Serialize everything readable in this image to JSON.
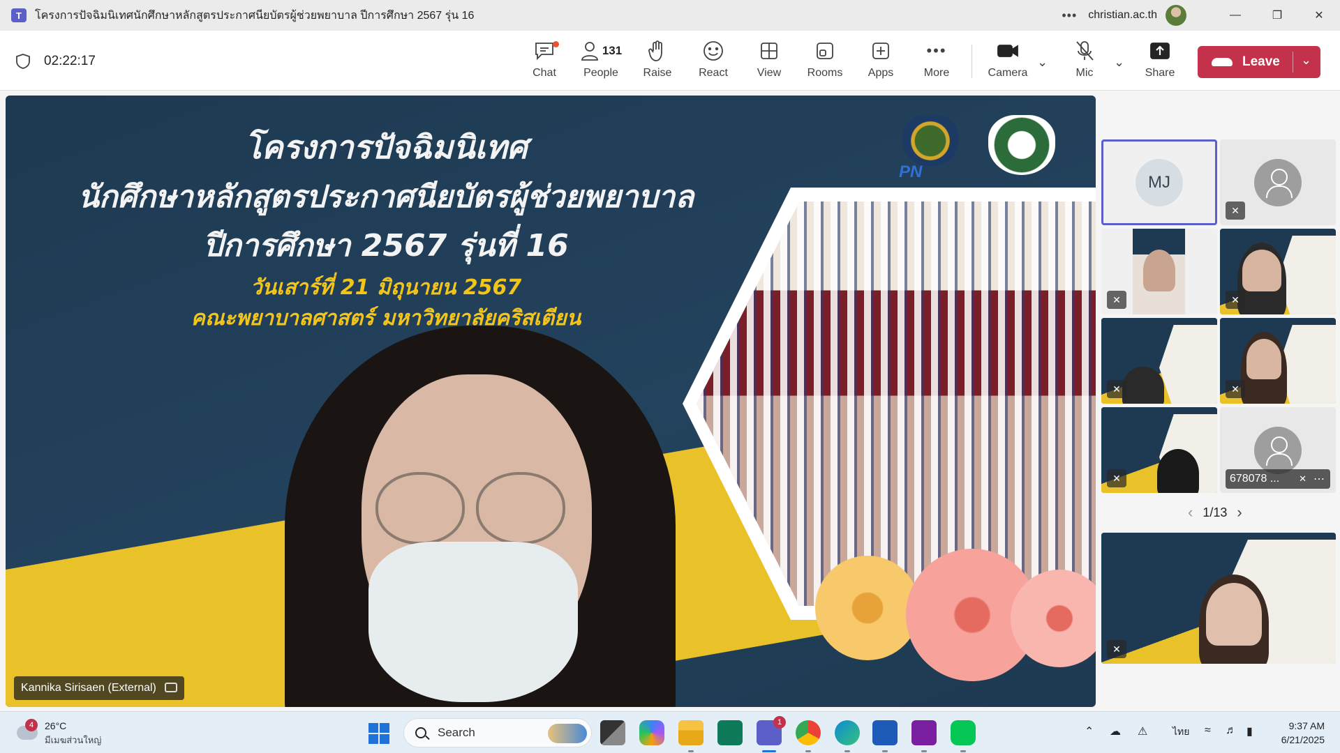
{
  "window": {
    "title": "โครงการปัจฉิมนิเทศนักศึกษาหลักสูตรประกาศนียบัตรผู้ช่วยพยาบาล ปีการศึกษา 2567 รุ่น 16",
    "account": "christian.ac.th",
    "more_icon": "ellipsis-icon"
  },
  "toolbar": {
    "timer": "02:22:17",
    "chat_label": "Chat",
    "people_label": "People",
    "people_count": "131",
    "raise_label": "Raise",
    "react_label": "React",
    "view_label": "View",
    "rooms_label": "Rooms",
    "apps_label": "Apps",
    "more_label": "More",
    "camera_label": "Camera",
    "mic_label": "Mic",
    "share_label": "Share",
    "leave_label": "Leave",
    "accent_color": "#5b5fc7",
    "leave_color": "#c4314b"
  },
  "stage": {
    "line1": "โครงการปัจฉิมนิเทศ",
    "line2": "นักศึกษาหลักสูตรประกาศนียบัตรผู้ช่วยพยาบาล",
    "line3": "ปีการศึกษา 2567 รุ่นที่ 16",
    "line4": "วันเสาร์ที่ 21 มิถุนายน 2567",
    "line5": "คณะพยาบาลศาสตร์ มหาวิทยาลัยคริสเตียน",
    "logo_text": "PN",
    "speaker_name": "Kannika Sirisaen (External)"
  },
  "gallery": {
    "self_initials": "MJ",
    "participant_label": "678078 ...",
    "page_indicator": "1/13"
  },
  "taskbar": {
    "weather_badge": "4",
    "temperature": "26°C",
    "condition": "มีเมฆส่วนใหญ่",
    "search_placeholder": "Search",
    "teams_badge": "1",
    "language": "ไทย",
    "time": "9:37 AM",
    "date": "6/21/2025"
  }
}
